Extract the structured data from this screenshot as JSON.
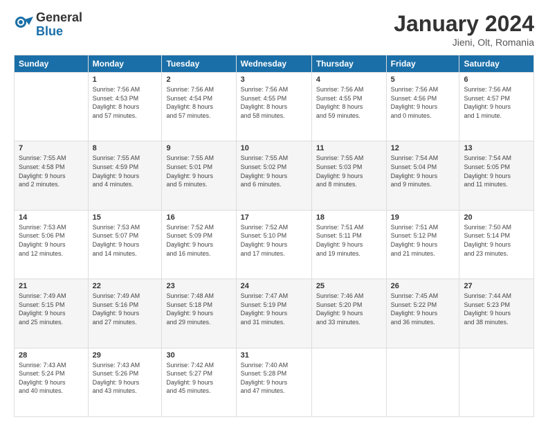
{
  "logo": {
    "general": "General",
    "blue": "Blue"
  },
  "title": {
    "month": "January 2024",
    "location": "Jieni, Olt, Romania"
  },
  "weekdays": [
    "Sunday",
    "Monday",
    "Tuesday",
    "Wednesday",
    "Thursday",
    "Friday",
    "Saturday"
  ],
  "weeks": [
    [
      {
        "day": "",
        "info": ""
      },
      {
        "day": "1",
        "info": "Sunrise: 7:56 AM\nSunset: 4:53 PM\nDaylight: 8 hours\nand 57 minutes."
      },
      {
        "day": "2",
        "info": "Sunrise: 7:56 AM\nSunset: 4:54 PM\nDaylight: 8 hours\nand 57 minutes."
      },
      {
        "day": "3",
        "info": "Sunrise: 7:56 AM\nSunset: 4:55 PM\nDaylight: 8 hours\nand 58 minutes."
      },
      {
        "day": "4",
        "info": "Sunrise: 7:56 AM\nSunset: 4:55 PM\nDaylight: 8 hours\nand 59 minutes."
      },
      {
        "day": "5",
        "info": "Sunrise: 7:56 AM\nSunset: 4:56 PM\nDaylight: 9 hours\nand 0 minutes."
      },
      {
        "day": "6",
        "info": "Sunrise: 7:56 AM\nSunset: 4:57 PM\nDaylight: 9 hours\nand 1 minute."
      }
    ],
    [
      {
        "day": "7",
        "info": "Sunrise: 7:55 AM\nSunset: 4:58 PM\nDaylight: 9 hours\nand 2 minutes."
      },
      {
        "day": "8",
        "info": "Sunrise: 7:55 AM\nSunset: 4:59 PM\nDaylight: 9 hours\nand 4 minutes."
      },
      {
        "day": "9",
        "info": "Sunrise: 7:55 AM\nSunset: 5:01 PM\nDaylight: 9 hours\nand 5 minutes."
      },
      {
        "day": "10",
        "info": "Sunrise: 7:55 AM\nSunset: 5:02 PM\nDaylight: 9 hours\nand 6 minutes."
      },
      {
        "day": "11",
        "info": "Sunrise: 7:55 AM\nSunset: 5:03 PM\nDaylight: 9 hours\nand 8 minutes."
      },
      {
        "day": "12",
        "info": "Sunrise: 7:54 AM\nSunset: 5:04 PM\nDaylight: 9 hours\nand 9 minutes."
      },
      {
        "day": "13",
        "info": "Sunrise: 7:54 AM\nSunset: 5:05 PM\nDaylight: 9 hours\nand 11 minutes."
      }
    ],
    [
      {
        "day": "14",
        "info": "Sunrise: 7:53 AM\nSunset: 5:06 PM\nDaylight: 9 hours\nand 12 minutes."
      },
      {
        "day": "15",
        "info": "Sunrise: 7:53 AM\nSunset: 5:07 PM\nDaylight: 9 hours\nand 14 minutes."
      },
      {
        "day": "16",
        "info": "Sunrise: 7:52 AM\nSunset: 5:09 PM\nDaylight: 9 hours\nand 16 minutes."
      },
      {
        "day": "17",
        "info": "Sunrise: 7:52 AM\nSunset: 5:10 PM\nDaylight: 9 hours\nand 17 minutes."
      },
      {
        "day": "18",
        "info": "Sunrise: 7:51 AM\nSunset: 5:11 PM\nDaylight: 9 hours\nand 19 minutes."
      },
      {
        "day": "19",
        "info": "Sunrise: 7:51 AM\nSunset: 5:12 PM\nDaylight: 9 hours\nand 21 minutes."
      },
      {
        "day": "20",
        "info": "Sunrise: 7:50 AM\nSunset: 5:14 PM\nDaylight: 9 hours\nand 23 minutes."
      }
    ],
    [
      {
        "day": "21",
        "info": "Sunrise: 7:49 AM\nSunset: 5:15 PM\nDaylight: 9 hours\nand 25 minutes."
      },
      {
        "day": "22",
        "info": "Sunrise: 7:49 AM\nSunset: 5:16 PM\nDaylight: 9 hours\nand 27 minutes."
      },
      {
        "day": "23",
        "info": "Sunrise: 7:48 AM\nSunset: 5:18 PM\nDaylight: 9 hours\nand 29 minutes."
      },
      {
        "day": "24",
        "info": "Sunrise: 7:47 AM\nSunset: 5:19 PM\nDaylight: 9 hours\nand 31 minutes."
      },
      {
        "day": "25",
        "info": "Sunrise: 7:46 AM\nSunset: 5:20 PM\nDaylight: 9 hours\nand 33 minutes."
      },
      {
        "day": "26",
        "info": "Sunrise: 7:45 AM\nSunset: 5:22 PM\nDaylight: 9 hours\nand 36 minutes."
      },
      {
        "day": "27",
        "info": "Sunrise: 7:44 AM\nSunset: 5:23 PM\nDaylight: 9 hours\nand 38 minutes."
      }
    ],
    [
      {
        "day": "28",
        "info": "Sunrise: 7:43 AM\nSunset: 5:24 PM\nDaylight: 9 hours\nand 40 minutes."
      },
      {
        "day": "29",
        "info": "Sunrise: 7:43 AM\nSunset: 5:26 PM\nDaylight: 9 hours\nand 43 minutes."
      },
      {
        "day": "30",
        "info": "Sunrise: 7:42 AM\nSunset: 5:27 PM\nDaylight: 9 hours\nand 45 minutes."
      },
      {
        "day": "31",
        "info": "Sunrise: 7:40 AM\nSunset: 5:28 PM\nDaylight: 9 hours\nand 47 minutes."
      },
      {
        "day": "",
        "info": ""
      },
      {
        "day": "",
        "info": ""
      },
      {
        "day": "",
        "info": ""
      }
    ]
  ]
}
